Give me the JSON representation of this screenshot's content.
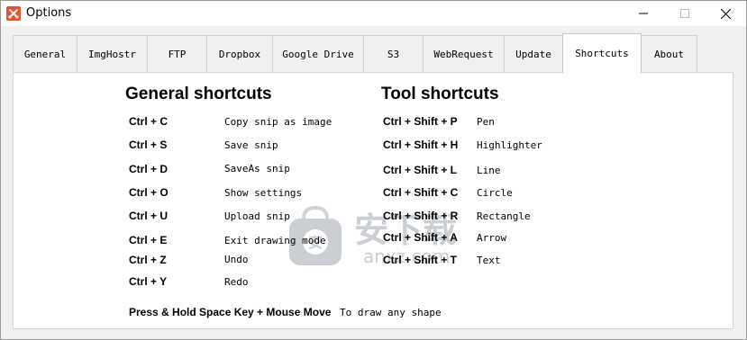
{
  "window": {
    "title": "Options",
    "accent": "#e8532b"
  },
  "tabs": [
    {
      "label": "General"
    },
    {
      "label": "ImgHostr"
    },
    {
      "label": "FTP"
    },
    {
      "label": "Dropbox"
    },
    {
      "label": "Google Drive"
    },
    {
      "label": "S3"
    },
    {
      "label": "WebRequest"
    },
    {
      "label": "Update"
    },
    {
      "label": "Shortcuts",
      "selected": true
    },
    {
      "label": "About"
    }
  ],
  "general": {
    "heading": "General shortcuts",
    "items": [
      {
        "key": "Ctrl + C",
        "action": "Copy snip as image"
      },
      {
        "key": "Ctrl + S",
        "action": "Save snip"
      },
      {
        "key": "Ctrl + D",
        "action": "SaveAs snip"
      },
      {
        "key": "Ctrl + O",
        "action": "Show settings"
      },
      {
        "key": "Ctrl + U",
        "action": "Upload snip"
      },
      {
        "key": "Ctrl + E",
        "action": "Exit drawing mode"
      },
      {
        "key": "Ctrl + Z",
        "action": "Undo"
      },
      {
        "key": "Ctrl + Y",
        "action": "Redo"
      }
    ],
    "footer_key": "Press & Hold Space Key + Mouse Move",
    "footer_action": "To draw any shape"
  },
  "tools": {
    "heading": "Tool shortcuts",
    "items": [
      {
        "key": "Ctrl + Shift + P",
        "action": "Pen"
      },
      {
        "key": "Ctrl + Shift + H",
        "action": "Highlighter"
      },
      {
        "key": "Ctrl + Shift + L",
        "action": "Line"
      },
      {
        "key": "Ctrl + Shift + C",
        "action": "Circle"
      },
      {
        "key": "Ctrl + Shift + R",
        "action": "Rectangle"
      },
      {
        "key": "Ctrl + Shift + A",
        "action": "Arrow"
      },
      {
        "key": "Ctrl + Shift + T",
        "action": "Text"
      }
    ]
  },
  "watermark": {
    "text": "安下载",
    "subtext": "anxz.com",
    "icon": "shield-bag-icon"
  }
}
